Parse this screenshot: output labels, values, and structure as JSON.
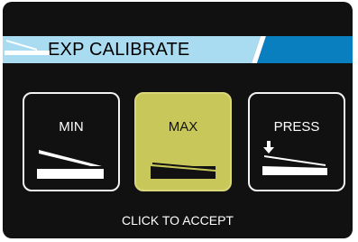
{
  "header": {
    "title": "EXP CALIBRATE",
    "pedal_icon": "expression-pedal-icon"
  },
  "options": [
    {
      "label": "MIN",
      "icon": "pedal-heel-down-icon",
      "selected": false
    },
    {
      "label": "MAX",
      "icon": "pedal-toe-down-icon",
      "selected": true
    },
    {
      "label": "PRESS",
      "icon": "pedal-press-icon",
      "selected": false
    }
  ],
  "footer": {
    "hint": "CLICK TO ACCEPT"
  },
  "colors": {
    "screen_bg": "#111111",
    "banner_light_blue": "#a9dcf0",
    "banner_dark_blue": "#0a7fbf",
    "selected_tile": "#c8c85a",
    "tile_border": "#f2f2f2",
    "text": "#ffffff"
  }
}
